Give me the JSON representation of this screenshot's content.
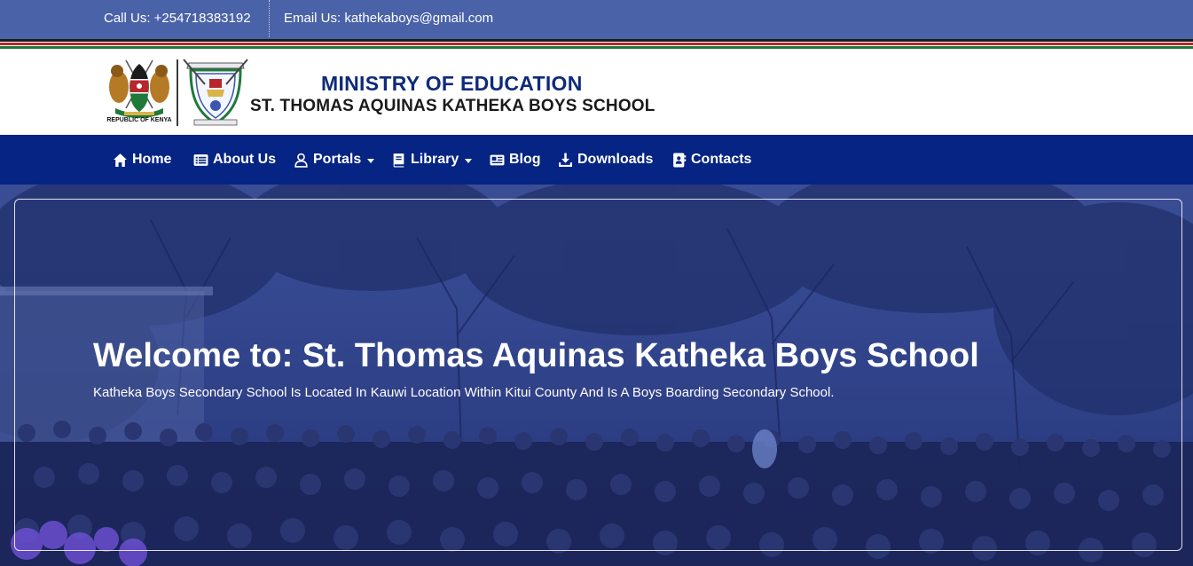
{
  "topbar": {
    "call": "Call Us: +254718383192",
    "email": "Email Us: kathekaboys@gmail.com"
  },
  "colors": {
    "topbar": "#4a62a8",
    "navbar": "#052483",
    "ministry_text": "#0e2a7a",
    "flag_black": "#1b1b1b",
    "flag_red": "#b8262d",
    "flag_green": "#1f7a3a"
  },
  "header": {
    "coat_of_arms_caption": "REPUBLIC OF KENYA",
    "ministry": "MINISTRY OF EDUCATION",
    "school": "ST. THOMAS AQUINAS KATHEKA BOYS SCHOOL"
  },
  "nav": {
    "items": [
      {
        "label": "Home",
        "icon": "home-icon",
        "dropdown": false
      },
      {
        "label": "About Us",
        "icon": "list-icon",
        "dropdown": false
      },
      {
        "label": "Portals",
        "icon": "user-icon",
        "dropdown": true
      },
      {
        "label": "Library",
        "icon": "book-icon",
        "dropdown": true
      },
      {
        "label": "Blog",
        "icon": "newspaper-icon",
        "dropdown": false
      },
      {
        "label": "Downloads",
        "icon": "download-icon",
        "dropdown": false
      },
      {
        "label": "Contacts",
        "icon": "address-book-icon",
        "dropdown": false
      }
    ]
  },
  "hero": {
    "welcome_prefix": "Welcome to: ",
    "school_name": "St. Thomas Aquinas Katheka Boys School",
    "tagline": "Katheka Boys Secondary School Is Located In Kauwi Location Within Kitui County And Is A Boys Boarding Secondary School."
  }
}
